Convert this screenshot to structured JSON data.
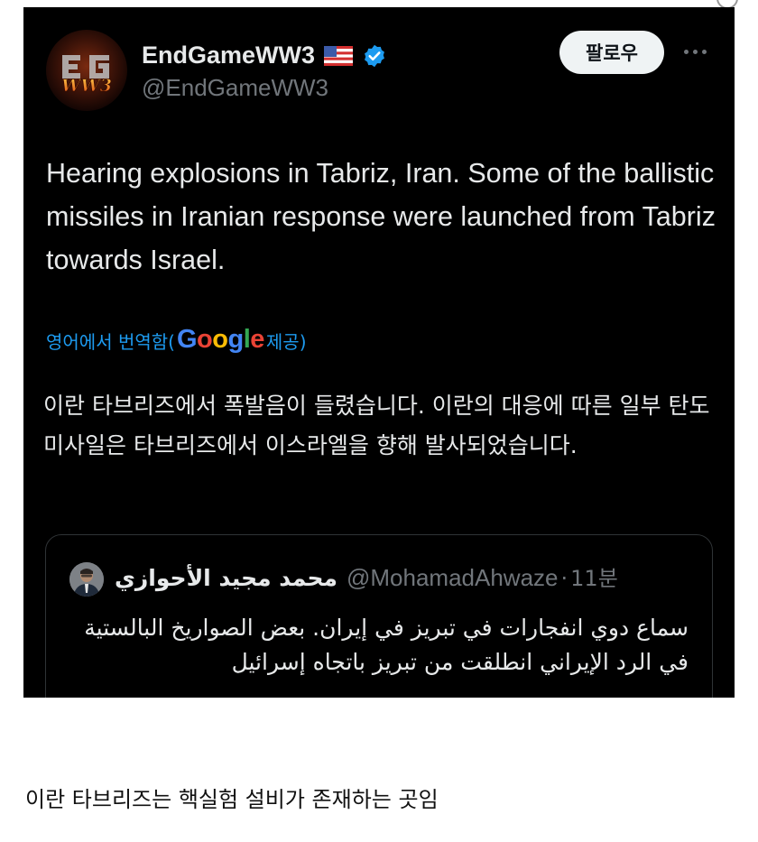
{
  "tweet": {
    "author_name": "EndGameWW3",
    "author_handle": "@EndGameWW3",
    "avatar_text": "WW3",
    "follow_label": "팔로우",
    "text": "Hearing explosions in Tabriz, Iran. Some of the ballistic missiles in Iranian response were launched from Tabriz towards Israel.",
    "translation": {
      "prefix": "영어에서 번역함(",
      "provider": "Google",
      "suffix": " 제공)",
      "text": "이란 타브리즈에서 폭발음이 들렸습니다. 이란의 대응에 따른 일부 탄도미사일은 타브리즈에서 이스라엘을 향해 발사되었습니다."
    },
    "quote": {
      "author_name": "محمد مجيد الأحوازي",
      "author_handle": "@MohamadAhwaze",
      "separator": "·",
      "time": "11분",
      "text": "سماع دوي انفجارات في تبريز في إيران. بعض الصواريخ البالستية في الرد الإيراني انطلقت من تبريز باتجاه إسرائيل"
    }
  },
  "caption": "이란 타브리즈는 핵실험 설비가 존재하는 곳임",
  "icons": {
    "flag": "us-flag-icon",
    "verified": "verified-badge-icon",
    "more": "more-options-icon"
  },
  "colors": {
    "card_background": "#000000",
    "link_blue": "#1d9bf0",
    "verified_blue": "#1d9bf0",
    "muted_text": "#71767b"
  }
}
